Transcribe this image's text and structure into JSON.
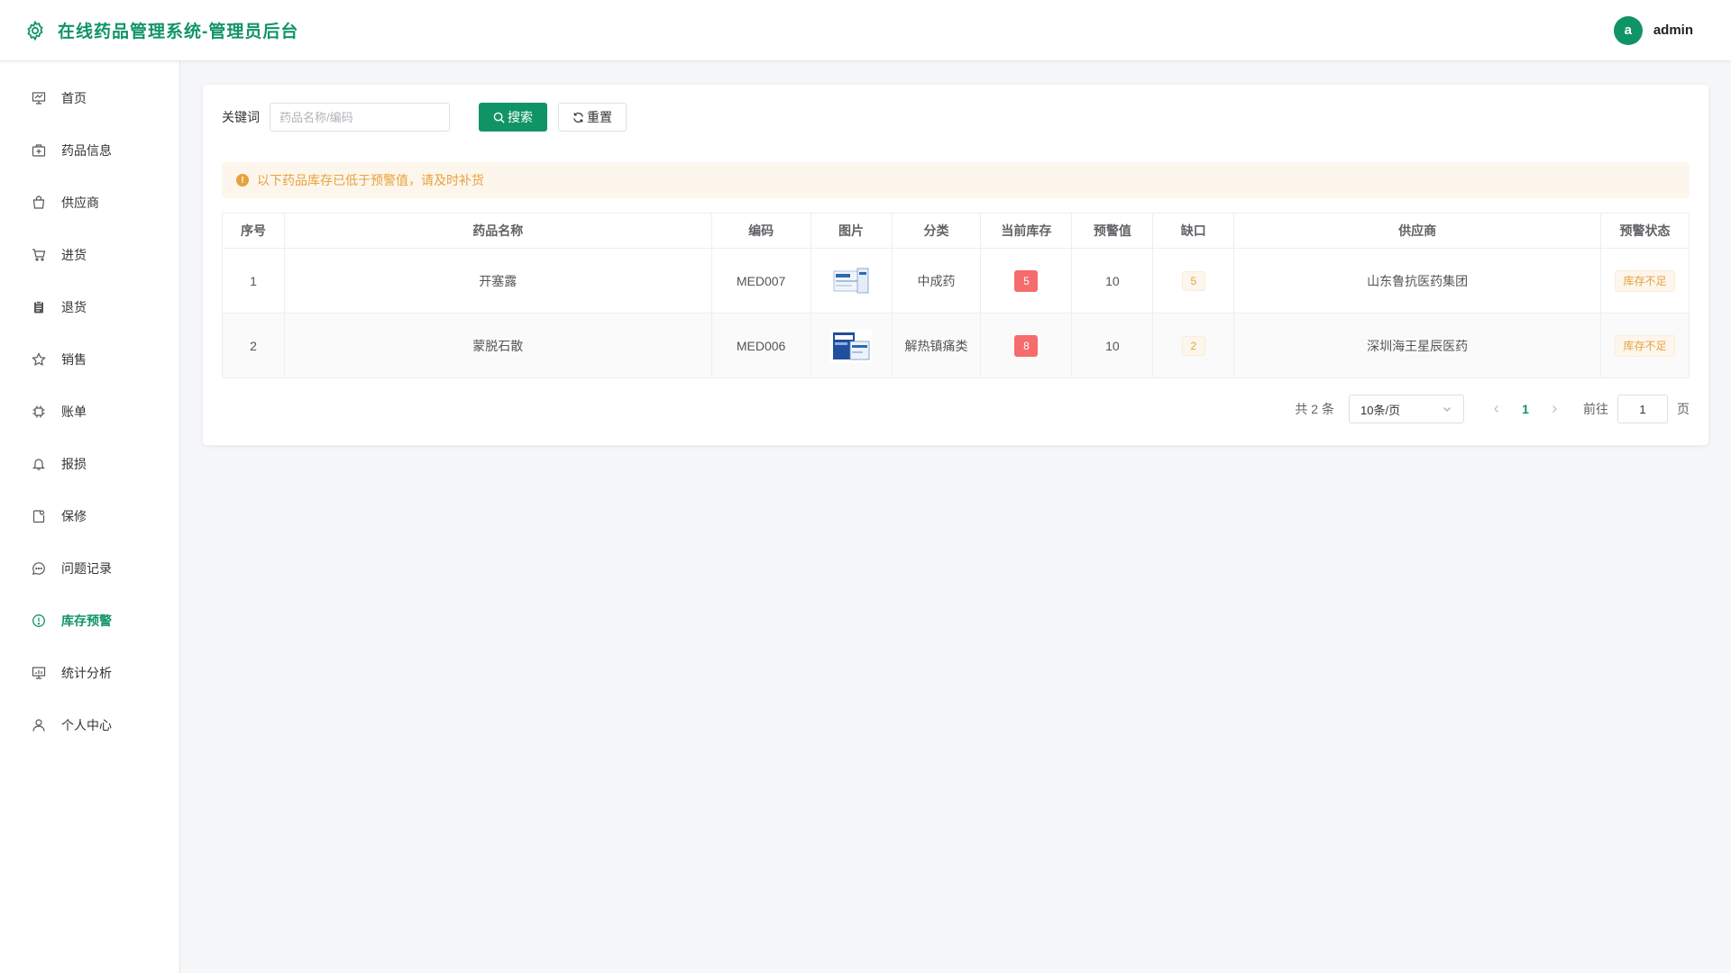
{
  "header": {
    "title": "在线药品管理系统-管理员后台",
    "avatar_letter": "a",
    "username": "admin"
  },
  "sidebar": {
    "items": [
      {
        "label": "首页",
        "icon": "presentation-icon"
      },
      {
        "label": "药品信息",
        "icon": "medicine-box-icon"
      },
      {
        "label": "供应商",
        "icon": "shopping-bag-icon"
      },
      {
        "label": "进货",
        "icon": "cart-icon"
      },
      {
        "label": "退货",
        "icon": "clipboard-icon"
      },
      {
        "label": "销售",
        "icon": "star-icon"
      },
      {
        "label": "账单",
        "icon": "cpu-icon"
      },
      {
        "label": "报损",
        "icon": "bell-icon"
      },
      {
        "label": "保修",
        "icon": "repair-icon"
      },
      {
        "label": "问题记录",
        "icon": "chat-bubble-icon"
      },
      {
        "label": "库存预警",
        "icon": "warning-circle-icon",
        "active": true
      },
      {
        "label": "统计分析",
        "icon": "chart-board-icon"
      },
      {
        "label": "个人中心",
        "icon": "user-icon"
      }
    ]
  },
  "search": {
    "label": "关键词",
    "placeholder": "药品名称/编码",
    "value": "",
    "search_label": "搜索",
    "reset_label": "重置"
  },
  "alert": {
    "text": "以下药品库存已低于预警值，请及时补货"
  },
  "table": {
    "columns": [
      "序号",
      "药品名称",
      "编码",
      "图片",
      "分类",
      "当前库存",
      "预警值",
      "缺口",
      "供应商",
      "预警状态"
    ],
    "rows": [
      {
        "index": "1",
        "name": "开塞露",
        "code": "MED007",
        "category": "中成药",
        "stock": "5",
        "threshold": "10",
        "gap": "5",
        "supplier": "山东鲁抗医药集团",
        "status": "库存不足"
      },
      {
        "index": "2",
        "name": "蒙脱石散",
        "code": "MED006",
        "category": "解热镇痛类",
        "stock": "8",
        "threshold": "10",
        "gap": "2",
        "supplier": "深圳海王星辰医药",
        "status": "库存不足"
      }
    ]
  },
  "pagination": {
    "total": "共 2 条",
    "page_size": "10条/页",
    "current_page": "1",
    "goto_label": "前往",
    "goto_value": "1",
    "goto_suffix": "页"
  },
  "colors": {
    "primary": "#119465",
    "danger": "#f56c6c",
    "warning": "#e6a23c"
  }
}
